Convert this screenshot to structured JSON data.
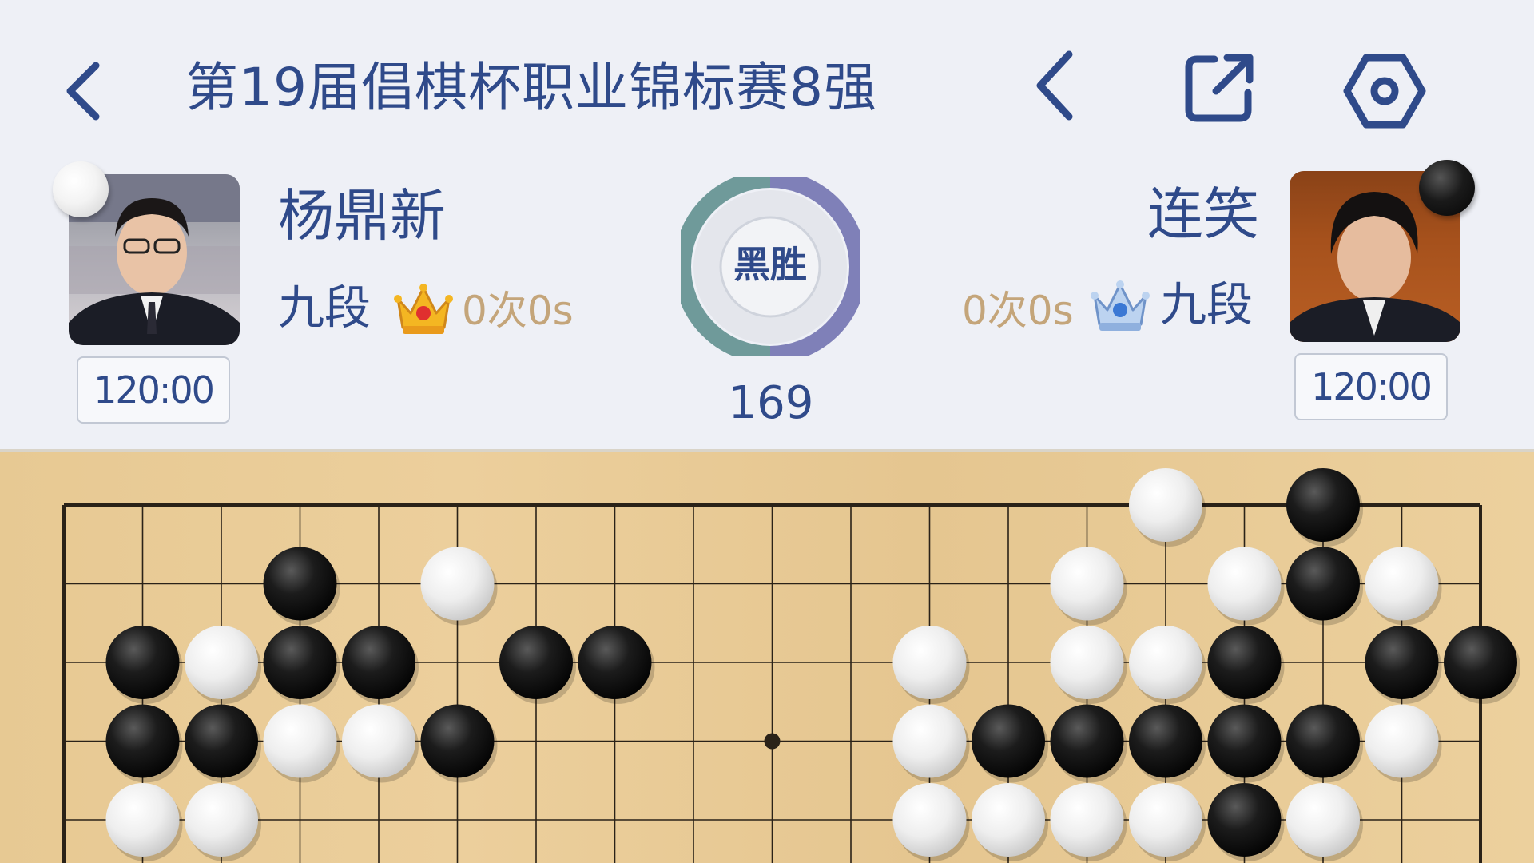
{
  "header": {
    "title": "第19届倡棋杯职业锦标赛8强",
    "back_icon": "chevron-left-icon",
    "prev_move_icon": "chevron-left-icon",
    "share_icon": "share-icon",
    "settings_icon": "settings-icon"
  },
  "players": {
    "white": {
      "name": "杨鼎新",
      "rank": "九段",
      "byoyomi": "0次0s",
      "clock": "120:00",
      "stone": "white",
      "badge_icon": "gold-crown-icon"
    },
    "black": {
      "name": "连笑",
      "rank": "九段",
      "byoyomi": "0次0s",
      "clock": "120:00",
      "stone": "black",
      "badge_icon": "blue-crown-icon"
    }
  },
  "result": {
    "label": "黑胜",
    "move_number": "169",
    "ring_colors": {
      "black_share": "#7f80b8",
      "white_share": "#6f9a9a"
    }
  },
  "colors": {
    "accent": "#2f4a8a",
    "byoyomi_text": "#c4a57a",
    "board": "#e7c993",
    "grid_line": "#2a2218"
  },
  "board": {
    "size": 19,
    "visible_rows": 5,
    "star_points": [
      [
        9,
        3
      ]
    ],
    "stones": [
      {
        "c": "W",
        "col": 14,
        "row": 0
      },
      {
        "c": "B",
        "col": 16,
        "row": 0
      },
      {
        "c": "B",
        "col": 3,
        "row": 1
      },
      {
        "c": "W",
        "col": 5,
        "row": 1
      },
      {
        "c": "W",
        "col": 13,
        "row": 1
      },
      {
        "c": "W",
        "col": 15,
        "row": 1
      },
      {
        "c": "B",
        "col": 16,
        "row": 1
      },
      {
        "c": "W",
        "col": 17,
        "row": 1
      },
      {
        "c": "B",
        "col": 1,
        "row": 2
      },
      {
        "c": "W",
        "col": 2,
        "row": 2
      },
      {
        "c": "B",
        "col": 3,
        "row": 2
      },
      {
        "c": "B",
        "col": 4,
        "row": 2
      },
      {
        "c": "B",
        "col": 6,
        "row": 2
      },
      {
        "c": "B",
        "col": 7,
        "row": 2
      },
      {
        "c": "W",
        "col": 11,
        "row": 2
      },
      {
        "c": "W",
        "col": 13,
        "row": 2
      },
      {
        "c": "W",
        "col": 14,
        "row": 2
      },
      {
        "c": "B",
        "col": 15,
        "row": 2
      },
      {
        "c": "B",
        "col": 17,
        "row": 2
      },
      {
        "c": "B",
        "col": 18,
        "row": 2
      },
      {
        "c": "B",
        "col": 1,
        "row": 3
      },
      {
        "c": "B",
        "col": 2,
        "row": 3
      },
      {
        "c": "W",
        "col": 3,
        "row": 3
      },
      {
        "c": "W",
        "col": 4,
        "row": 3
      },
      {
        "c": "B",
        "col": 5,
        "row": 3
      },
      {
        "c": "W",
        "col": 11,
        "row": 3
      },
      {
        "c": "B",
        "col": 12,
        "row": 3
      },
      {
        "c": "B",
        "col": 13,
        "row": 3
      },
      {
        "c": "B",
        "col": 14,
        "row": 3
      },
      {
        "c": "B",
        "col": 15,
        "row": 3
      },
      {
        "c": "B",
        "col": 16,
        "row": 3
      },
      {
        "c": "W",
        "col": 17,
        "row": 3
      },
      {
        "c": "W",
        "col": 1,
        "row": 4
      },
      {
        "c": "W",
        "col": 2,
        "row": 4
      },
      {
        "c": "W",
        "col": 11,
        "row": 4
      },
      {
        "c": "W",
        "col": 12,
        "row": 4
      },
      {
        "c": "W",
        "col": 13,
        "row": 4
      },
      {
        "c": "W",
        "col": 14,
        "row": 4
      },
      {
        "c": "B",
        "col": 15,
        "row": 4
      },
      {
        "c": "W",
        "col": 16,
        "row": 4
      }
    ]
  }
}
